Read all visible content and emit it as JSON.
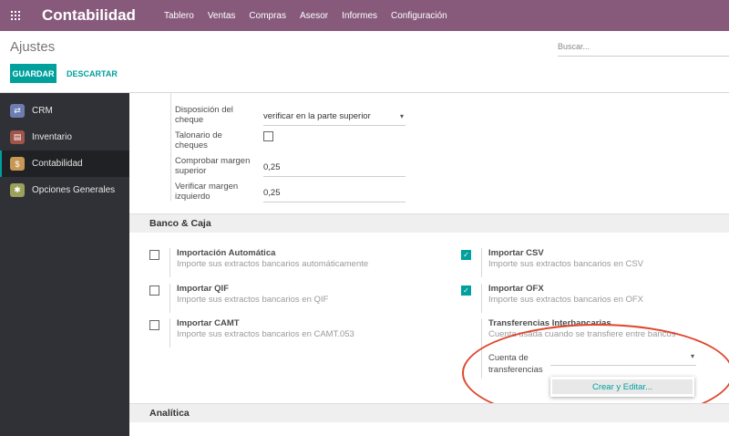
{
  "app": {
    "brand": "Contabilidad",
    "menu": [
      "Tablero",
      "Ventas",
      "Compras",
      "Asesor",
      "Informes",
      "Configuración"
    ]
  },
  "control": {
    "title": "Ajustes",
    "search_placeholder": "Buscar...",
    "save_label": "GUARDAR",
    "discard_label": "DESCARTAR"
  },
  "sidebar": {
    "items": [
      {
        "label": "CRM",
        "icon": "crm-icon"
      },
      {
        "label": "Inventario",
        "icon": "inventory-icon"
      },
      {
        "label": "Contabilidad",
        "icon": "accounting-icon",
        "active": true
      },
      {
        "label": "Opciones Generales",
        "icon": "gear-icon"
      }
    ]
  },
  "checks": {
    "layout_label": "Disposición del cheque",
    "layout_value": "verificar en la parte superior",
    "stub_label": "Talonario de cheques",
    "top_margin_label": "Comprobar margen superior",
    "top_margin_value": "0,25",
    "left_margin_label": "Verificar margen izquierdo",
    "left_margin_value": "0,25"
  },
  "bank": {
    "section_title": "Banco & Caja",
    "options": [
      {
        "title": "Importación Automática",
        "desc": "Importe sus extractos bancarios automáticamente",
        "checked": false
      },
      {
        "title": "Importar CSV",
        "desc": "Importe sus extractos bancarios en CSV",
        "checked": true
      },
      {
        "title": "Importar QIF",
        "desc": "Importe sus extractos bancarios en QIF",
        "checked": false
      },
      {
        "title": "Importar OFX",
        "desc": "Importe sus extractos bancarios en OFX",
        "checked": true
      },
      {
        "title": "Importar CAMT",
        "desc": "Importe sus extractos bancarios en CAMT.053",
        "checked": false
      },
      {
        "title": "Transferencias Interbancarias",
        "desc": "Cuenta usada cuando se transfiere entre bancos"
      }
    ],
    "transfer_account_label": "Cuenta de transferencias",
    "dropdown_create_edit": "Crear y Editar..."
  },
  "analytic": {
    "section_title": "Analítica"
  },
  "colors": {
    "brand": "#875a7b",
    "accent": "#00a09d",
    "highlight_oval": "#e0462e"
  }
}
